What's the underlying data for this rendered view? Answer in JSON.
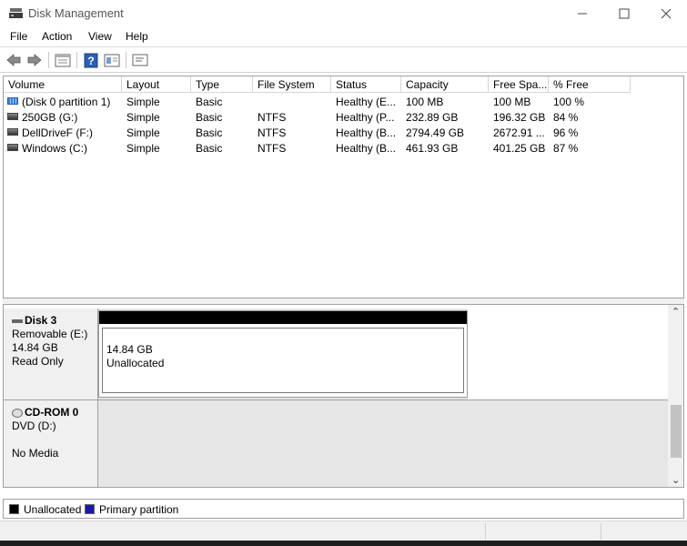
{
  "window": {
    "title": "Disk Management",
    "icon": "disk-management-icon",
    "controls": [
      "minimize-icon",
      "maximize-icon",
      "close-icon"
    ]
  },
  "menu": [
    "File",
    "Action",
    "View",
    "Help"
  ],
  "toolbar": {
    "icons": [
      "back-arrow-icon",
      "forward-arrow-icon",
      "disk-list-icon",
      "help-icon",
      "properties-icon",
      "console-icon"
    ]
  },
  "volume_table": {
    "columns": [
      "Volume",
      "Layout",
      "Type",
      "File System",
      "Status",
      "Capacity",
      "Free Spa...",
      "% Free"
    ],
    "rows": [
      [
        "(Disk 0 partition 1)",
        "Simple",
        "Basic",
        "",
        "Healthy (E...",
        "100 MB",
        "100 MB",
        "100 %"
      ],
      [
        "250GB (G:)",
        "Simple",
        "Basic",
        "NTFS",
        "Healthy (P...",
        "232.89 GB",
        "196.32 GB",
        "84 %"
      ],
      [
        "DellDriveF (F:)",
        "Simple",
        "Basic",
        "NTFS",
        "Healthy (B...",
        "2794.49 GB",
        "2672.91 ...",
        "96 %"
      ],
      [
        "Windows (C:)",
        "Simple",
        "Basic",
        "NTFS",
        "Healthy (B...",
        "461.93 GB",
        "401.25 GB",
        "87 %"
      ]
    ]
  },
  "disks": [
    {
      "name": "Disk 3",
      "type": "Removable (E:)",
      "size": "14.84 GB",
      "status": "Read Only",
      "partition": {
        "size": "14.84 GB",
        "label": "Unallocated"
      }
    },
    {
      "name": "CD-ROM 0",
      "type": "DVD (D:)",
      "size": "",
      "status": "No Media"
    }
  ],
  "legend": [
    {
      "label": "Unallocated",
      "color": "#000000"
    },
    {
      "label": "Primary partition",
      "color": "#1a1aa6"
    }
  ],
  "colors": {
    "unallocated": "#000000",
    "primary": "#1a1aa6"
  }
}
